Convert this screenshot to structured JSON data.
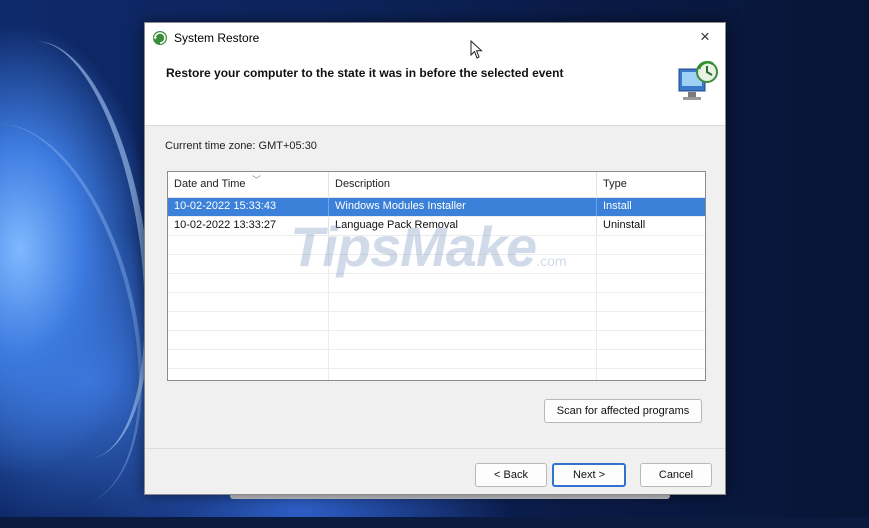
{
  "window": {
    "title": "System Restore",
    "heading": "Restore your computer to the state it was in before the selected event",
    "close_glyph": "×"
  },
  "timezone": "Current time zone: GMT+05:30",
  "table": {
    "columns": [
      "Date and Time",
      "Description",
      "Type"
    ],
    "rows": [
      {
        "date": "10-02-2022 15:33:43",
        "description": "Windows Modules Installer",
        "type": "Install"
      },
      {
        "date": "10-02-2022 13:33:27",
        "description": "Language Pack Removal",
        "type": "Uninstall"
      }
    ]
  },
  "watermark": {
    "main": "TipsMake",
    "suffix": ".com"
  },
  "buttons": {
    "scan": "Scan for affected programs",
    "back": "< Back",
    "next": "Next >",
    "cancel": "Cancel"
  },
  "colors": {
    "selection": "#3b80d9",
    "focus_border": "#2f73cf"
  },
  "icons": {
    "app": "system-restore-icon",
    "header": "restore-computer-icon",
    "cursor": "mouse-pointer-icon"
  }
}
